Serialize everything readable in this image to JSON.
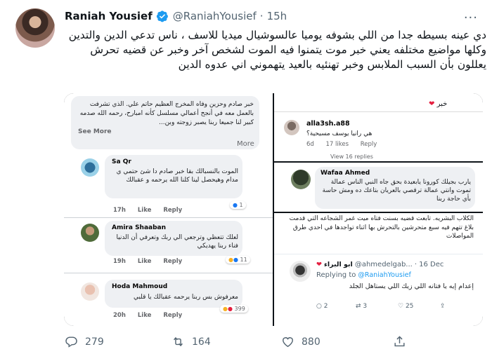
{
  "tweet": {
    "name": "Raniah Yousief",
    "handle": "@RaniahYousief",
    "separator": "·",
    "time": "15h",
    "more_icon": "more-horizontal-icon",
    "text": "دي عينه بسيطه جدا من اللي بشوفه يوميا عالسوشيال ميديا للاسف ، ناس تدعي الدين والتدين وكلها مواضيع مختلفه يعني خبر موت يتمنوا فيه الموت لشخص آخر وخبر عن قضيه تحرش يعللون بأن السبب الملابس وخبر تهنئيه بالعيد يتهموني اني عدوه الدين"
  },
  "screenshot1": {
    "post_text": "خبر صادم وحزين وفاه المخرج العظيم حاتم علي. الذي تشرفت بالعمل معه في أنجح أعمالي مسلسل كأنه امبارح، رحمه الله صدمه كبير لنا جميعا ربنا يصبر زوجته وبن...",
    "see_more": "See More",
    "comments": [
      {
        "name": "Sa Qr",
        "text": "الموت بالنسبالك بقا خبر صادم دا شئ حتمي ي مدام وهيحصل لينا كلنا الله يرحمه و عقبالك",
        "time": "17h",
        "like": "Like",
        "reply": "Reply",
        "reactions": "1"
      },
      {
        "name": "Amira Shaaban",
        "text": "لعلك تتعظي وترجعي الي ربك وتعرفي أن الدنيا فناء ربنا يهديكي",
        "time": "19h",
        "like": "Like",
        "reply": "Reply",
        "reactions": "11"
      },
      {
        "name": "Hoda Mahmoud",
        "text": "معرفوش بس ربنا يرحمه عقبالك يا قلبي",
        "time": "20h",
        "like": "Like",
        "reply": "Reply",
        "reactions": "399"
      }
    ]
  },
  "screenshot2": {
    "top_text": "خبر",
    "name": "alla3sh.a88",
    "text": "هي رانيا يوسف مسيحية؟",
    "time": "6d",
    "likes": "17 likes",
    "reply": "Reply",
    "view_replies": "View 16 replies"
  },
  "screenshot3": {
    "name": "Wafaa Ahmed",
    "text": "يارب بجيلك كورونا يابعيدة بحق جاه النبي الناس عمالة تموت وانتي عمالة ترقصي بالعريان بتاعك ده ومش حاسة بأي حاجة ربنا"
  },
  "screenshot4": {
    "post_text": "الكلاب البشريه. تابعت قضيه بسنت فتاه ميت غمر الشجاعه التي قدمت بلاغ تتهم فيه سبع متحرشين بالتحرش بها اثناء تواجدها في احدي طرق المواصلات",
    "name": "ابو البراء",
    "handle": "@ahmedelgab...",
    "date": "16 Dec",
    "replying_label": "Replying to",
    "replying_to": "@RaniahYousief",
    "text": "إعدام إيه يا فتانه اللي زيك اللي يستاهل الجلد",
    "replies": "2",
    "retweets": "3",
    "likes": "25"
  },
  "actions": {
    "replies": "279",
    "retweets": "164",
    "likes": "880"
  },
  "colors": {
    "verified": "#1d9bf0",
    "text_secondary": "#536471",
    "heart_red": "#e41e3f"
  }
}
